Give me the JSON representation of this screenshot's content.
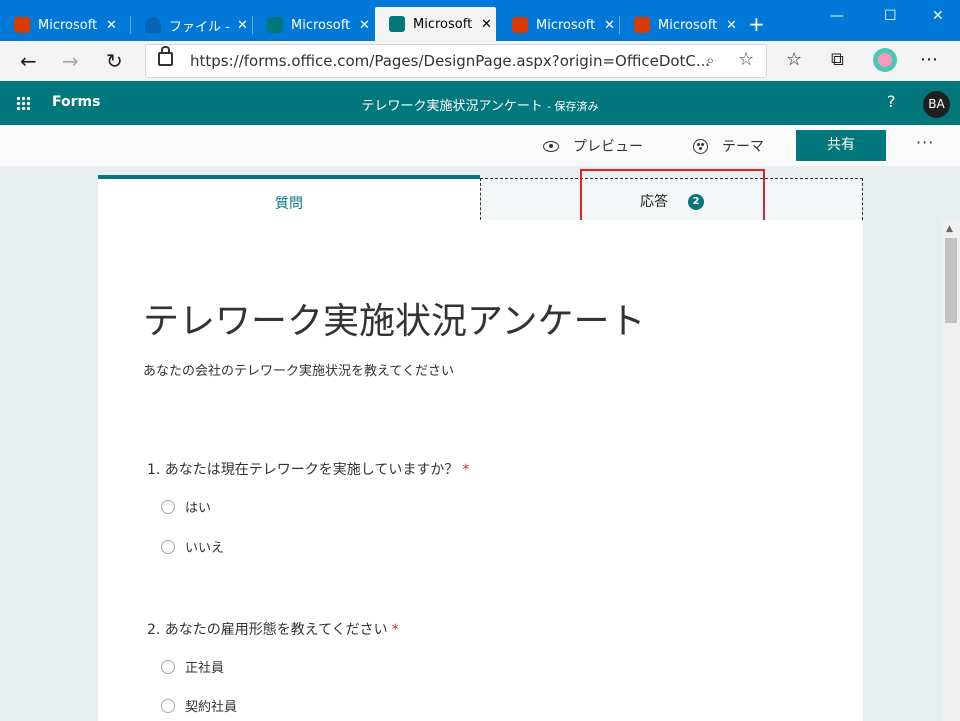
{
  "browser": {
    "tabs": [
      {
        "label": "Microsoft",
        "icon": "office-icon",
        "color": "#d83b01",
        "active": false
      },
      {
        "label": "ファイル - O",
        "icon": "onedrive-icon",
        "color": "#0364b8",
        "active": false
      },
      {
        "label": "Microsoft",
        "icon": "forms-icon",
        "color": "#03787c",
        "active": false
      },
      {
        "label": "Microsoft",
        "icon": "forms-icon",
        "color": "#03787c",
        "active": true
      },
      {
        "label": "Microsoft",
        "icon": "office-icon",
        "color": "#d83b01",
        "active": false
      },
      {
        "label": "Microsoft",
        "icon": "office-icon",
        "color": "#d83b01",
        "active": false
      }
    ],
    "url": "https://forms.office.com/Pages/DesignPage.aspx?origin=OfficeDotC..."
  },
  "app": {
    "brand": "Forms",
    "doc_title": "テレワーク実施状況アンケート",
    "save_status": "- 保存済み",
    "help": "?",
    "avatar_initials": "BA"
  },
  "toolbar": {
    "preview_label": "プレビュー",
    "theme_label": "テーマ",
    "share_label": "共有",
    "more_label": "···"
  },
  "form_tabs": {
    "questions_label": "質問",
    "responses_label": "応答",
    "responses_count": "2"
  },
  "form": {
    "title": "テレワーク実施状況アンケート",
    "description": "あなたの会社のテレワーク実施状況を教えてください",
    "questions": [
      {
        "text": "1. あなたは現在テレワークを実施していますか？",
        "required_mark": "*",
        "options": [
          "はい",
          "いいえ"
        ]
      },
      {
        "text": "2. あなたの雇用形態を教えてください",
        "required_mark": "*",
        "options": [
          "正社員",
          "契約社員"
        ]
      }
    ]
  },
  "colors": {
    "accent": "#03787c",
    "browser_blue": "#0078d7",
    "highlight": "#e0202a"
  }
}
